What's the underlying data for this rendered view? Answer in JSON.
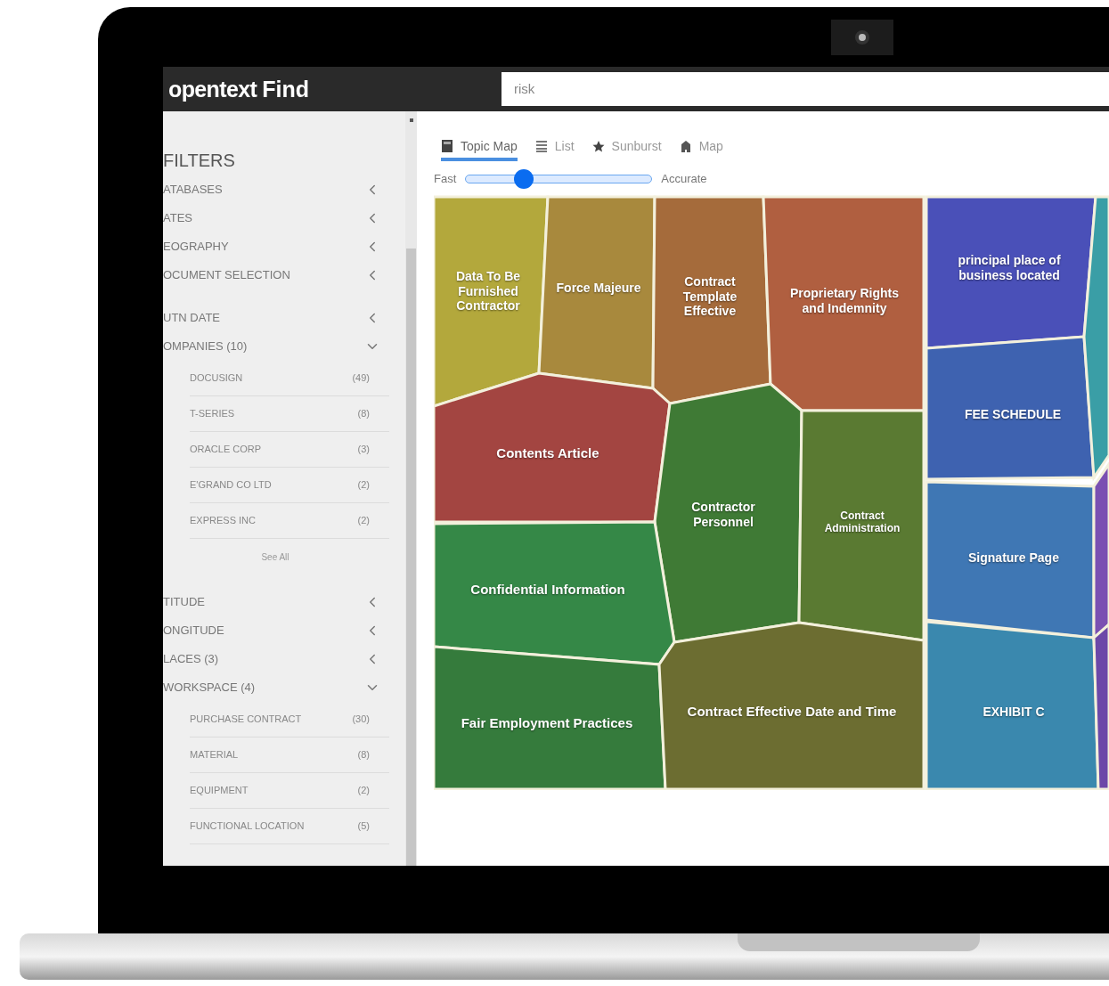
{
  "header": {
    "logo": "opentext",
    "product": "Find",
    "search": {
      "value": "risk"
    }
  },
  "sidebar": {
    "title": "FILTERS",
    "sections": [
      {
        "label": "ATABASES",
        "expanded": false
      },
      {
        "label": "ATES",
        "expanded": false
      },
      {
        "label": "EOGRAPHY",
        "expanded": false
      },
      {
        "label": "OCUMENT SELECTION",
        "expanded": false
      },
      {
        "label": "UTN DATE",
        "expanded": false
      },
      {
        "label": "OMPANIES (10)",
        "expanded": true,
        "items": [
          {
            "label": "DOCUSIGN",
            "count": "(49)"
          },
          {
            "label": "T-SERIES",
            "count": "(8)"
          },
          {
            "label": "ORACLE CORP",
            "count": "(3)"
          },
          {
            "label": "E'GRAND CO LTD",
            "count": "(2)"
          },
          {
            "label": "EXPRESS INC",
            "count": "(2)"
          }
        ],
        "see_all": "See All"
      },
      {
        "label": "TITUDE",
        "expanded": false
      },
      {
        "label": "ONGITUDE",
        "expanded": false
      },
      {
        "label": "LACES (3)",
        "expanded": false
      },
      {
        "label": "WORKSPACE (4)",
        "expanded": true,
        "items": [
          {
            "label": "PURCHASE CONTRACT",
            "count": "(30)"
          },
          {
            "label": "MATERIAL",
            "count": "(8)"
          },
          {
            "label": "EQUIPMENT",
            "count": "(2)"
          },
          {
            "label": "FUNCTIONAL LOCATION",
            "count": "(5)"
          }
        ]
      }
    ]
  },
  "tabs": [
    {
      "label": "Topic Map",
      "selected": true
    },
    {
      "label": "List",
      "selected": false
    },
    {
      "label": "Sunburst",
      "selected": false
    },
    {
      "label": "Map",
      "selected": false
    }
  ],
  "slider": {
    "min_label": "Fast",
    "max_label": "Accurate",
    "level": 0.29
  },
  "topic_map": [
    {
      "label": "Data To Be Furnished Contractor",
      "color": "#b3a83c"
    },
    {
      "label": "Force Majeure",
      "color": "#a8893d"
    },
    {
      "label": "Contract Template Effective",
      "color": "#a56b3b"
    },
    {
      "label": "Proprietary Rights and Indemnity",
      "color": "#b05f40"
    },
    {
      "label": "Contents Article",
      "color": "#a34541"
    },
    {
      "label": "Contractor Personnel",
      "color": "#3f7a35"
    },
    {
      "label": "Contract Administration",
      "color": "#5a7a32"
    },
    {
      "label": "Confidential Information",
      "color": "#358847"
    },
    {
      "label": "Fair Employment Practices",
      "color": "#357b3c"
    },
    {
      "label": "Contract Effective Date and Time",
      "color": "#6c6d31"
    },
    {
      "label": "principal place of business located",
      "color": "#4a50b8"
    },
    {
      "label": "FEE SCHEDULE",
      "color": "#3e62b0"
    },
    {
      "label": "Signature Page",
      "color": "#3f77b4"
    },
    {
      "label": "EXHIBIT C",
      "color": "#3a88ae"
    },
    {
      "color": "#3a9ea6"
    },
    {
      "color": "#7a50b2"
    },
    {
      "color": "#6c48a8"
    }
  ]
}
